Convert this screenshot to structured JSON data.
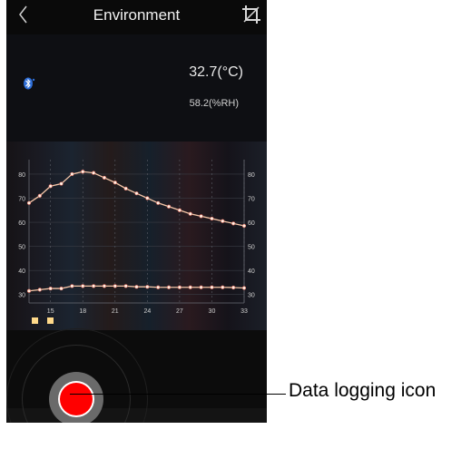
{
  "header": {
    "title": "Environment",
    "back_icon": "chevron-left-icon",
    "crop_icon": "crop-icon"
  },
  "readings": {
    "temperature": "32.7(°C)",
    "humidity": "58.2(%RH)",
    "bluetooth_icon": "bluetooth-icon"
  },
  "chart_data": {
    "type": "line",
    "x_ticks": [
      "15",
      "18",
      "21",
      "24",
      "27",
      "30",
      "33"
    ],
    "y_ticks_left": [
      "80",
      "70",
      "60",
      "50",
      "40",
      "30"
    ],
    "y_ticks_right": [
      "80",
      "70",
      "60",
      "50",
      "40",
      "30"
    ],
    "ylim": [
      30,
      80
    ],
    "x": [
      13,
      14,
      15,
      16,
      17,
      18,
      19,
      20,
      21,
      22,
      23,
      24,
      25,
      26,
      27,
      28,
      29,
      30,
      31,
      32,
      33
    ],
    "series": [
      {
        "values": [
          68,
          71,
          75,
          76,
          80,
          81,
          80.5,
          78.5,
          76.5,
          74,
          72,
          70,
          68,
          66.5,
          65,
          63.5,
          62.5,
          61.5,
          60.5,
          59.5,
          58.5
        ],
        "color": "#f5c6a8"
      },
      {
        "values": [
          31.5,
          32,
          32.5,
          32.5,
          33.5,
          33.5,
          33.5,
          33.5,
          33.5,
          33.5,
          33.2,
          33.2,
          33,
          33,
          33,
          33,
          33,
          33,
          33,
          32.9,
          32.7
        ],
        "color": "#f5c6a8"
      }
    ],
    "grid": true
  },
  "callout": {
    "label": "Data logging icon"
  },
  "colors": {
    "record": "#ff0000",
    "line": "#f5c6a8",
    "point": "#fff2e6"
  }
}
